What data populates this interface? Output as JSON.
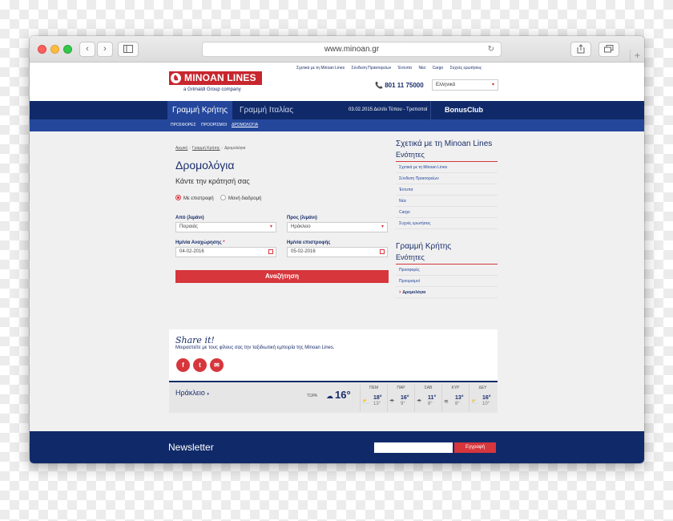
{
  "browser": {
    "url": "www.minoan.gr",
    "nav_back": "‹",
    "nav_forward": "›",
    "new_tab": "+"
  },
  "header": {
    "logo_text": "MINOAN LINES",
    "logo_tagline": "a Grimaldi Group company",
    "top_links": [
      "Σχετικά με τη Minoan Lines",
      "Σύνδεση Πρακτορείων",
      "Έντυπα",
      "Νέα",
      "Cargo",
      "Συχνές ερωτήσεις"
    ],
    "phone": "801 11 75000",
    "language": "Ελληνικά"
  },
  "nav": {
    "tab_active": "Γραμμή Κρήτης",
    "tab_second": "Γραμμή Ιταλίας",
    "ticker": "03.02.2015 Δελτίο Τύπου - Τροποποί",
    "bonus": "BonusClub",
    "subnav": [
      "ΠΡΟΣΦΟΡΕΣ",
      "ΠΡΟΟΡΙΣΜΟΙ",
      "ΔΡΟΜΟΛΟΓΙΑ"
    ]
  },
  "breadcrumb": [
    "Αρχική",
    "Γραμμή Κρήτης",
    "Δρομολόγια"
  ],
  "booking": {
    "title": "Δρομολόγια",
    "subtitle": "Κάντε την κράτησή σας",
    "radio_return": "Με επιστροφή",
    "radio_oneway": "Μονή διαδρομή",
    "from_label": "Από (λιμάνι)",
    "from_value": "Πειραιάς",
    "to_label": "Προς (λιμάνι)",
    "to_value": "Ηράκλειο",
    "depart_label": "Ημ/νία Αναχώρησης",
    "depart_required": "*",
    "depart_value": "04-02-2016",
    "return_label": "Ημ/νία επιστροφής",
    "return_value": "05-02-2016",
    "search_button": "Αναζήτηση"
  },
  "sidebar": {
    "about_title": "Σχετικά με τη Minoan Lines",
    "about_section": "Ενότητες",
    "about_links": [
      "Σχετικά με τη Minoan Lines",
      "Σύνδεση Πρακτορείων",
      "Έντυπα",
      "Νέα",
      "Cargo",
      "Συχνές ερωτήσεις"
    ],
    "crete_title": "Γραμμή Κρήτης",
    "crete_section": "Ενότητες",
    "crete_links": [
      "Προσφορές",
      "Προορισμοί",
      "Δρομολόγια"
    ]
  },
  "share": {
    "title": "Share it!",
    "text": "Μοιραστείτε με τους φίλους σας την ταξιδιωτική εμπειρία της Minoan Lines.",
    "facebook": "f",
    "twitter": "t",
    "email": "✉"
  },
  "weather": {
    "city": "Ηράκλειο",
    "city_caret": "▾",
    "now_label": "ΤΩΡΑ",
    "now_temp": "16°",
    "days": [
      {
        "name": "ΠΕΜ",
        "hi": "18°",
        "lo": "13°"
      },
      {
        "name": "ΠΑΡ",
        "hi": "16°",
        "lo": "9°"
      },
      {
        "name": "ΣΑΒ",
        "hi": "11°",
        "lo": "8°"
      },
      {
        "name": "ΚΥΡ",
        "hi": "13°",
        "lo": "8°"
      },
      {
        "name": "ΔΕΥ",
        "hi": "16°",
        "lo": "10°"
      }
    ]
  },
  "newsletter": {
    "title": "Newsletter",
    "button": "Εγγραφή"
  },
  "colors": {
    "navy": "#102a69",
    "blue": "#24479c",
    "red": "#d6363c"
  }
}
